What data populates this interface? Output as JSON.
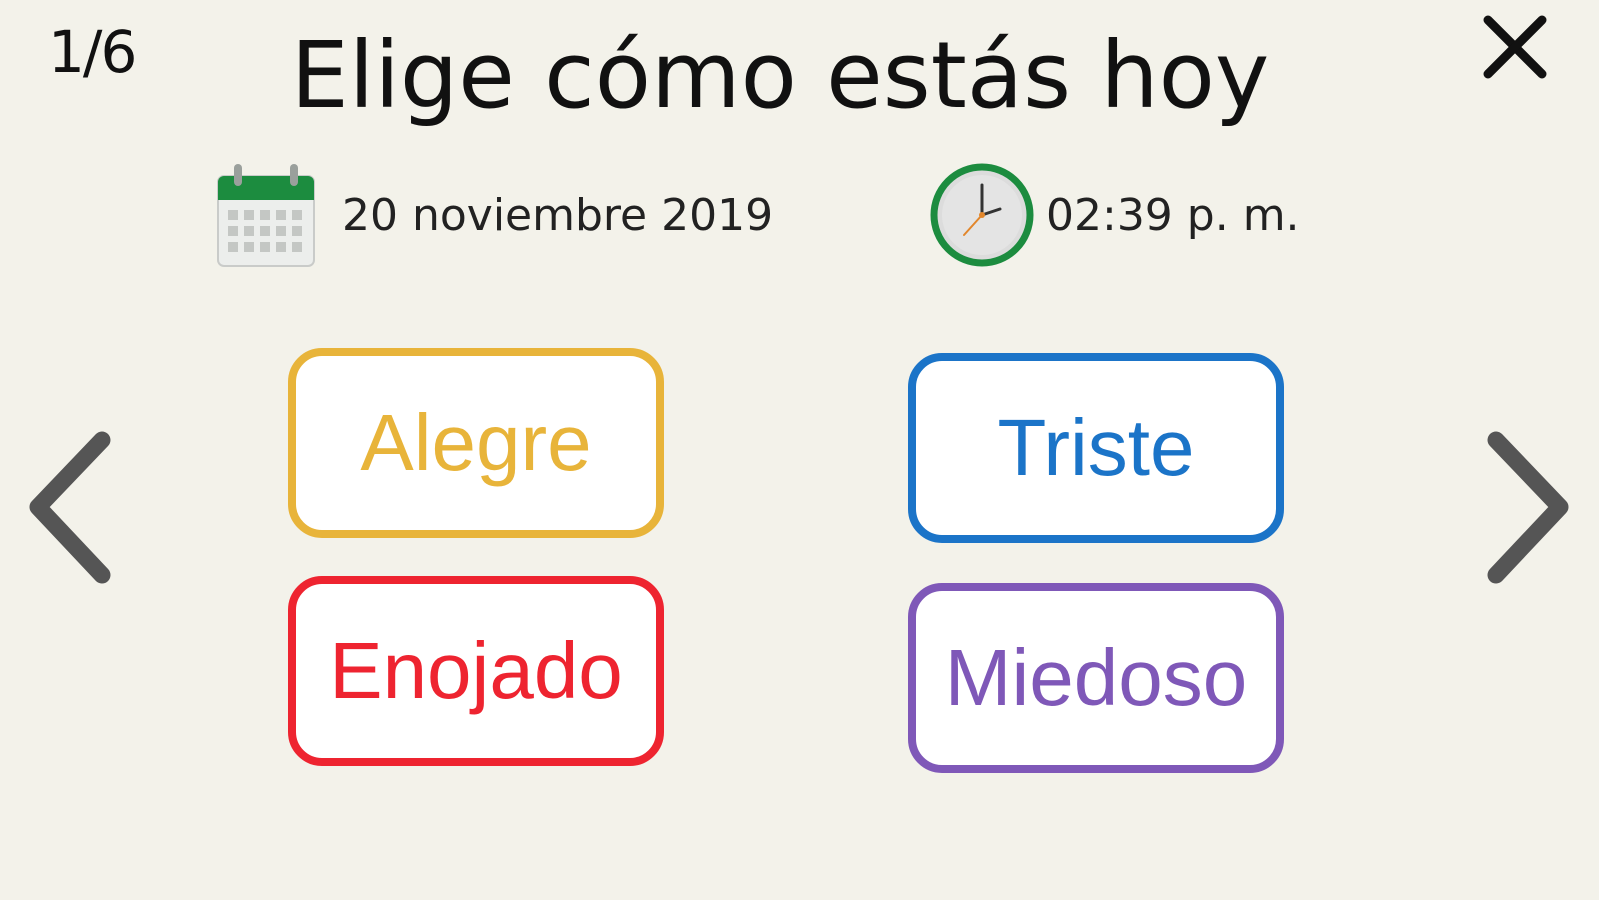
{
  "header": {
    "page_counter": "1/6",
    "title": "Elige cómo estás hoy",
    "close_icon": "close-icon"
  },
  "info": {
    "date": "20 noviembre 2019",
    "time": "02:39 p. m.",
    "calendar_icon": "calendar-icon",
    "clock_icon": "clock-icon"
  },
  "emotions": [
    {
      "label": "Alegre",
      "color": "#e8b43a"
    },
    {
      "label": "Triste",
      "color": "#1b74c8"
    },
    {
      "label": "Enojado",
      "color": "#ee2430"
    },
    {
      "label": "Miedoso",
      "color": "#7f58b8"
    }
  ],
  "nav": {
    "prev_icon": "chevron-left-icon",
    "next_icon": "chevron-right-icon",
    "arrow_color": "#555555"
  }
}
